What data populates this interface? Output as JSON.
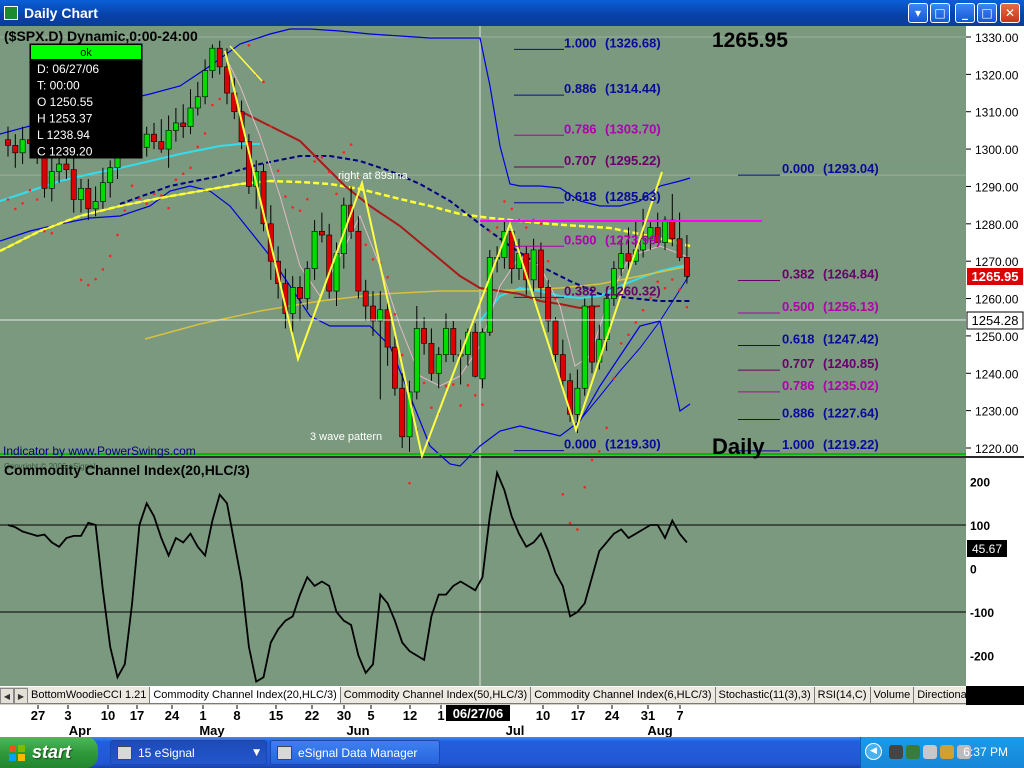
{
  "window": {
    "title": "Daily Chart",
    "buttons": {
      "blue": "▾",
      "min": "_",
      "max": "□",
      "close": "✕"
    }
  },
  "price_panel": {
    "symbol_label": "($SPX.D) Dynamic,0:00-24:00",
    "last_price": "1265.95",
    "last_price_tag": "1265.95",
    "cursor_price_tag": "1254.28",
    "interval_label": "Daily",
    "credit": "Indicator by www.PowerSwings.com",
    "copyright": "Copyright © 2006 eSignal",
    "y_ticks": [
      "1330.00",
      "1320.00",
      "1310.00",
      "1300.00",
      "1290.00",
      "1280.00",
      "1270.00",
      "1260.00",
      "1250.00",
      "1240.00",
      "1230.00",
      "1220.00"
    ],
    "data_window": {
      "status": "ok",
      "rows": [
        "D: 06/27/06",
        "T: 00:00",
        "O 1250.55",
        "H 1253.37",
        "L 1238.94",
        "C 1239.20"
      ]
    },
    "annotations": {
      "ma_note": "right at 89sma",
      "wave_note": "3 wave pattern"
    },
    "fib_left": [
      {
        "label": "1.000",
        "value": "(1326.68)",
        "color": "#0a0a9a"
      },
      {
        "label": "0.886",
        "value": "(1314.44)",
        "color": "#0a0a9a"
      },
      {
        "label": "0.786",
        "value": "(1303.70)",
        "color": "#b000b0"
      },
      {
        "label": "0.707",
        "value": "(1295.22)",
        "color": "#6a006a"
      },
      {
        "label": "0.618",
        "value": "(1285.63)",
        "color": "#0a0a9a"
      },
      {
        "label": "0.500",
        "value": "(1273.99)",
        "color": "#b000b0"
      },
      {
        "label": "0.382",
        "value": "(1260.32)",
        "color": "#6a006a"
      },
      {
        "label": "0.000",
        "value": "(1219.30)",
        "color": "#0a0a9a"
      }
    ],
    "fib_right": [
      {
        "label": "0.000",
        "value": "(1293.04)",
        "color": "#0a0a9a"
      },
      {
        "label": "0.382",
        "value": "(1264.84)",
        "color": "#6a006a"
      },
      {
        "label": "0.500",
        "value": "(1256.13)",
        "color": "#b000b0"
      },
      {
        "label": "0.618",
        "value": "(1247.42)",
        "color": "#0a0a9a"
      },
      {
        "label": "0.707",
        "value": "(1240.85)",
        "color": "#6a006a"
      },
      {
        "label": "0.786",
        "value": "(1235.02)",
        "color": "#b000b0"
      },
      {
        "label": "0.886",
        "value": "(1227.64)",
        "color": "#0a0a9a"
      },
      {
        "label": "1.000",
        "value": "(1219.22)",
        "color": "#0a0a9a"
      }
    ]
  },
  "cci_panel": {
    "title": "Commodity Channel Index(20,HLC/3)",
    "value_tag": "45.67",
    "y_ticks": [
      "200",
      "100",
      "0",
      "-100",
      "-200"
    ]
  },
  "tabs": [
    "BottomWoodieCCI 1.21",
    "Commodity Channel Index(20,HLC/3)",
    "Commodity Channel Index(50,HLC/3)",
    "Commodity Channel Index(6,HLC/3)",
    "Stochastic(11(3),3)",
    "RSI(14,C)",
    "Volume",
    "Directional"
  ],
  "x_axis": {
    "day_ticks": [
      "27",
      "3",
      "10",
      "17",
      "24",
      "1",
      "8",
      "15",
      "22",
      "30",
      "5",
      "12",
      "1",
      "10",
      "17",
      "24",
      "31",
      "7"
    ],
    "month_labels": [
      "Apr",
      "May",
      "Jun",
      "Jul",
      "Aug"
    ],
    "cursor_date": "06/27/06"
  },
  "taskbar": {
    "start_label": "start",
    "tasks": [
      "15 eSignal",
      "eSignal Data Manager"
    ],
    "clock": "6:37 PM"
  },
  "colors": {
    "chart_bg": "#7a997e",
    "axis_bg": "#ffffff",
    "bull_candle": "#00dd00",
    "bear_candle": "#dd0000",
    "bollinger": "#0000dd",
    "ma_yellow": "#ffff33",
    "ma_cyan": "#33ddee",
    "ma_red": "#aa1a1a",
    "ma_navy": "#000080",
    "ma_orange": "#d8c040",
    "sar": "#ff2222",
    "fib_magenta_line": "#ff00ff",
    "support_green": "#00bb00"
  },
  "icons": {
    "app": "esignal-app-icon",
    "start": "windows-flag-icon"
  },
  "chart_data": [
    {
      "type": "candlestick",
      "title": "($SPX.D) Dynamic,0:00-24:00",
      "ylim": [
        1215,
        1335
      ],
      "x": [
        "03/27/06",
        "03/28",
        "03/29",
        "03/30",
        "03/31",
        "04/03",
        "04/04",
        "04/05",
        "04/06",
        "04/07",
        "04/10",
        "04/11",
        "04/12",
        "04/13",
        "04/17",
        "04/18",
        "04/19",
        "04/20",
        "04/21",
        "04/24",
        "04/25",
        "04/26",
        "04/27",
        "04/28",
        "05/01",
        "05/02",
        "05/03",
        "05/04",
        "05/05",
        "05/08",
        "05/09",
        "05/10",
        "05/11",
        "05/12",
        "05/15",
        "05/16",
        "05/17",
        "05/18",
        "05/19",
        "05/22",
        "05/23",
        "05/24",
        "05/25",
        "05/26",
        "05/30",
        "05/31",
        "06/01",
        "06/02",
        "06/05",
        "06/06",
        "06/07",
        "06/08",
        "06/09",
        "06/12",
        "06/13",
        "06/14",
        "06/15",
        "06/16",
        "06/19",
        "06/20",
        "06/21",
        "06/22",
        "06/23",
        "06/26",
        "06/27",
        "06/28",
        "06/29",
        "06/30",
        "07/03",
        "07/05",
        "07/06",
        "07/07",
        "07/10",
        "07/11",
        "07/12",
        "07/13",
        "07/14",
        "07/17",
        "07/18",
        "07/19",
        "07/20",
        "07/21",
        "07/24",
        "07/25",
        "07/26",
        "07/27",
        "07/28",
        "07/31",
        "08/01",
        "08/02",
        "08/03",
        "08/04",
        "08/07",
        "08/08"
      ],
      "open": [
        1302.5,
        1301.0,
        1299.0,
        1302.5,
        1301.5,
        1298.0,
        1289.5,
        1294.0,
        1296.0,
        1294.5,
        1286.5,
        1289.5,
        1284.0,
        1286.0,
        1291.0,
        1295.0,
        1299.0,
        1311.0,
        1306.0,
        1300.5,
        1304.0,
        1302.0,
        1300.0,
        1305.0,
        1307.0,
        1306.0,
        1311.0,
        1314.0,
        1321.0,
        1327.0,
        1322.0,
        1315.0,
        1310.0,
        1302.0,
        1290.0,
        1294.0,
        1280.0,
        1270.0,
        1264.0,
        1256.0,
        1263.0,
        1260.0,
        1268.0,
        1278.0,
        1277.0,
        1262.0,
        1272.0,
        1285.0,
        1278.0,
        1262.0,
        1258.0,
        1254.0,
        1257.0,
        1247.0,
        1236.0,
        1223.0,
        1235.0,
        1252.0,
        1248.0,
        1240.0,
        1245.0,
        1252.0,
        1245.0,
        1245.0,
        1251.0,
        1238.5,
        1251.0,
        1271.0,
        1271.0,
        1278.0,
        1268.0,
        1272.0,
        1265.0,
        1273.0,
        1263.0,
        1254.0,
        1245.0,
        1238.0,
        1229.0,
        1236.0,
        1258.0,
        1243.0,
        1249.0,
        1260.0,
        1268.0,
        1272.0,
        1270.0,
        1273.0,
        1276.0,
        1279.0,
        1275.0,
        1281.0,
        1276.0,
        1271.0
      ],
      "high": [
        1306.0,
        1304.0,
        1306.0,
        1306.0,
        1304.0,
        1302.0,
        1298.0,
        1300.0,
        1300.0,
        1298.0,
        1292.0,
        1292.0,
        1290.0,
        1295.0,
        1297.0,
        1302.0,
        1315.0,
        1313.0,
        1310.0,
        1306.0,
        1307.0,
        1308.0,
        1309.0,
        1311.0,
        1312.0,
        1316.0,
        1318.0,
        1324.0,
        1328.0,
        1329.0,
        1327.0,
        1319.0,
        1313.0,
        1304.0,
        1297.0,
        1296.0,
        1285.0,
        1274.0,
        1268.0,
        1266.0,
        1266.0,
        1270.0,
        1281.0,
        1283.0,
        1280.0,
        1275.0,
        1287.0,
        1290.0,
        1282.0,
        1265.0,
        1262.0,
        1262.0,
        1259.0,
        1250.0,
        1240.0,
        1238.0,
        1258.0,
        1255.0,
        1252.0,
        1247.0,
        1256.0,
        1254.0,
        1249.0,
        1252.0,
        1253.4,
        1252.0,
        1273.0,
        1274.0,
        1281.0,
        1279.0,
        1276.0,
        1274.0,
        1276.0,
        1275.0,
        1265.0,
        1255.0,
        1249.0,
        1240.0,
        1241.0,
        1260.0,
        1261.0,
        1253.0,
        1263.0,
        1270.0,
        1276.0,
        1279.0,
        1281.0,
        1284.0,
        1281.0,
        1283.0,
        1282.0,
        1288.0,
        1283.0,
        1277.0
      ],
      "low": [
        1298.0,
        1295.0,
        1296.0,
        1299.0,
        1296.0,
        1287.0,
        1286.0,
        1291.0,
        1292.0,
        1283.0,
        1283.0,
        1281.0,
        1282.0,
        1284.0,
        1287.0,
        1292.0,
        1298.0,
        1304.0,
        1300.0,
        1298.0,
        1300.0,
        1299.0,
        1295.0,
        1302.0,
        1303.0,
        1304.0,
        1309.0,
        1312.0,
        1319.0,
        1320.0,
        1312.0,
        1308.0,
        1300.0,
        1288.0,
        1284.0,
        1278.0,
        1265.0,
        1260.0,
        1252.0,
        1251.0,
        1254.0,
        1257.0,
        1265.0,
        1275.0,
        1260.0,
        1258.0,
        1268.0,
        1276.0,
        1260.0,
        1254.0,
        1250.0,
        1233.0,
        1242.0,
        1234.0,
        1220.0,
        1219.0,
        1233.0,
        1245.0,
        1238.0,
        1236.0,
        1243.0,
        1243.0,
        1237.0,
        1242.0,
        1238.9,
        1236.0,
        1250.0,
        1267.0,
        1268.0,
        1264.0,
        1265.0,
        1261.0,
        1262.0,
        1260.0,
        1251.0,
        1243.0,
        1236.0,
        1227.0,
        1224.0,
        1234.0,
        1240.0,
        1241.0,
        1246.0,
        1258.0,
        1266.0,
        1267.0,
        1269.0,
        1271.0,
        1273.0,
        1276.0,
        1273.0,
        1274.0,
        1270.0,
        1264.0
      ],
      "close": [
        1301.0,
        1299.0,
        1302.5,
        1301.5,
        1298.0,
        1289.5,
        1294.0,
        1296.0,
        1294.5,
        1286.5,
        1289.5,
        1284.0,
        1286.0,
        1291.0,
        1295.0,
        1299.0,
        1311.0,
        1306.0,
        1300.5,
        1304.0,
        1302.0,
        1300.0,
        1305.0,
        1307.0,
        1306.0,
        1311.0,
        1314.0,
        1321.0,
        1327.0,
        1322.0,
        1315.0,
        1310.0,
        1302.0,
        1290.0,
        1294.0,
        1280.0,
        1270.0,
        1264.0,
        1256.0,
        1263.0,
        1260.0,
        1268.0,
        1278.0,
        1277.0,
        1262.0,
        1272.0,
        1285.0,
        1278.0,
        1262.0,
        1258.0,
        1254.0,
        1257.0,
        1247.0,
        1236.0,
        1223.0,
        1235.0,
        1252.0,
        1248.0,
        1240.0,
        1245.0,
        1252.0,
        1245.0,
        1245.0,
        1251.0,
        1239.2,
        1251.0,
        1271.0,
        1271.0,
        1278.0,
        1268.0,
        1272.0,
        1265.0,
        1273.0,
        1263.0,
        1254.0,
        1245.0,
        1238.0,
        1229.0,
        1236.0,
        1258.0,
        1243.0,
        1249.0,
        1260.0,
        1268.0,
        1272.0,
        1270.0,
        1273.0,
        1276.0,
        1279.0,
        1275.0,
        1281.0,
        1276.0,
        1271.0,
        1265.95
      ],
      "overlays": {
        "horizontal_levels": [
          1281.0,
          1254.28,
          1219.3
        ],
        "fibonacci_left_levels": [
          1326.68,
          1314.44,
          1303.7,
          1295.22,
          1285.63,
          1273.99,
          1260.32,
          1219.3
        ],
        "fibonacci_right_levels": [
          1293.04,
          1264.84,
          1256.13,
          1247.42,
          1240.85,
          1235.02,
          1227.64,
          1219.22
        ],
        "swing_lines": [
          {
            "points": [
              [
                "05/08",
                1326
              ],
              [
                "05/22",
                1244
              ],
              [
                "06/02",
                1290
              ],
              [
                "06/14",
                1219
              ],
              [
                "06/28",
                1279
              ],
              [
                "07/13",
                1225
              ],
              [
                "07/31",
                1295
              ]
            ]
          },
          {
            "points": [
              [
                "05/08",
                1326
              ],
              [
                "05/22",
                1244
              ],
              [
                "06/02",
                1290
              ]
            ]
          }
        ]
      }
    },
    {
      "type": "line",
      "title": "Commodity Channel Index(20,HLC/3)",
      "ylim": [
        -280,
        240
      ],
      "y_ticks": [
        200,
        100,
        0,
        -100,
        -200
      ],
      "series": [
        {
          "name": "Commodity Channel Index(20,HLC/3)",
          "values": [
            100,
            95,
            85,
            80,
            75,
            78,
            60,
            50,
            70,
            75,
            75,
            105,
            100,
            -50,
            -180,
            -250,
            -220,
            -80,
            100,
            150,
            120,
            70,
            30,
            70,
            60,
            80,
            50,
            30,
            110,
            170,
            150,
            60,
            -30,
            -180,
            -260,
            -250,
            -170,
            -140,
            -120,
            -110,
            -60,
            -20,
            -40,
            -30,
            -40,
            -100,
            -120,
            -130,
            -200,
            -240,
            -220,
            -60,
            -80,
            -120,
            -170,
            -190,
            -200,
            -210,
            -110,
            -60,
            -60,
            -40,
            -30,
            -40,
            -50,
            -20,
            120,
            220,
            180,
            120,
            80,
            50,
            60,
            80,
            40,
            -10,
            -40,
            -110,
            -100,
            -80,
            -20,
            40,
            60,
            80,
            90,
            70,
            80,
            90,
            100,
            100,
            70,
            110,
            80,
            60
          ]
        }
      ]
    }
  ]
}
